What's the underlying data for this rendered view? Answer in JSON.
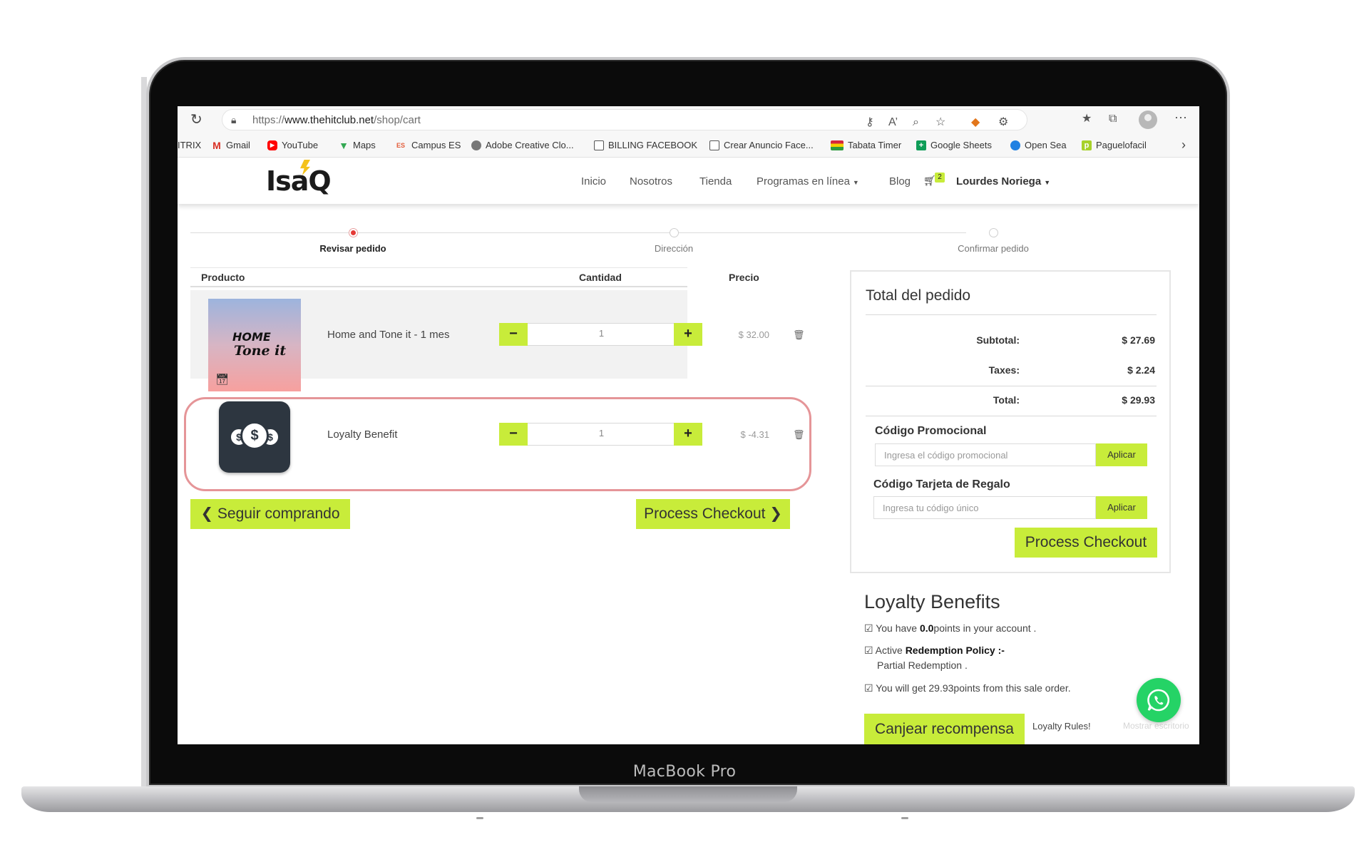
{
  "device": {
    "label": "MacBook Pro"
  },
  "browser": {
    "url_prefix": "https://",
    "url_domain": "www.thehitclub.net",
    "url_path": "/shop/cart",
    "bookmarks": [
      {
        "label": "ITRIX",
        "icon": "none"
      },
      {
        "label": "Gmail",
        "icon": "gmail-icon"
      },
      {
        "label": "YouTube",
        "icon": "youtube-icon"
      },
      {
        "label": "Maps",
        "icon": "maps-icon"
      },
      {
        "label": "Campus ES",
        "icon": "campus-icon"
      },
      {
        "label": "Adobe Creative Clo...",
        "icon": "adobe-icon"
      },
      {
        "label": "BILLING FACEBOOK",
        "icon": "page-icon"
      },
      {
        "label": "Crear Anuncio Face...",
        "icon": "page-icon"
      },
      {
        "label": "Tabata Timer",
        "icon": "flag-icon"
      },
      {
        "label": "Google Sheets",
        "icon": "sheets-icon"
      },
      {
        "label": "Open Sea",
        "icon": "opensea-icon"
      },
      {
        "label": "Paguelofacil",
        "icon": "paguelofacil-icon"
      }
    ]
  },
  "site": {
    "logo": "IsaQ",
    "nav": {
      "inicio": "Inicio",
      "nosotros": "Nosotros",
      "tienda": "Tienda",
      "programas": "Programas en línea",
      "blog": "Blog",
      "cart_count": "2",
      "user": "Lourdes Noriega"
    }
  },
  "steps": [
    "Revisar pedido",
    "Dirección",
    "Confirmar pedido"
  ],
  "cart": {
    "headers": {
      "product": "Producto",
      "quantity": "Cantidad",
      "price": "Precio"
    },
    "items": [
      {
        "image_text_1": "HOME",
        "image_text_2": "Tone it",
        "name": "Home and Tone it - 1 mes",
        "qty": "1",
        "price": "$ 32.00"
      },
      {
        "name": "Loyalty Benefit",
        "qty": "1",
        "price": "$ -4.31"
      }
    ],
    "continue_label": "Seguir comprando",
    "checkout_label": "Process Checkout"
  },
  "summary": {
    "title": "Total del pedido",
    "subtotal_label": "Subtotal:",
    "subtotal": "$ 27.69",
    "taxes_label": "Taxes:",
    "taxes": "$ 2.24",
    "total_label": "Total:",
    "total": "$ 29.93",
    "promo_title": "Código Promocional",
    "promo_placeholder": "Ingresa el código promocional",
    "gift_title": "Código Tarjeta de Regalo",
    "gift_placeholder": "Ingresa tu código único",
    "apply_label": "Aplicar",
    "checkout_label": "Process Checkout"
  },
  "loyalty": {
    "title": "Loyalty Benefits",
    "points_pre": "You have ",
    "points_value": "0.0",
    "points_post": "points in your account .",
    "active_pre": "Active ",
    "active_bold": "Redemption Policy :-",
    "active_detail": "Partial Redemption .",
    "earn_text": "You will get 29.93points from this sale order.",
    "redeem_label": "Canjear recompensa",
    "rules_label": "Loyalty Rules!",
    "faint_label": "Mostrar escritorio"
  },
  "colors": {
    "accent": "#c8ec3a",
    "highlight": "#e59598",
    "whatsapp": "#25d366"
  }
}
